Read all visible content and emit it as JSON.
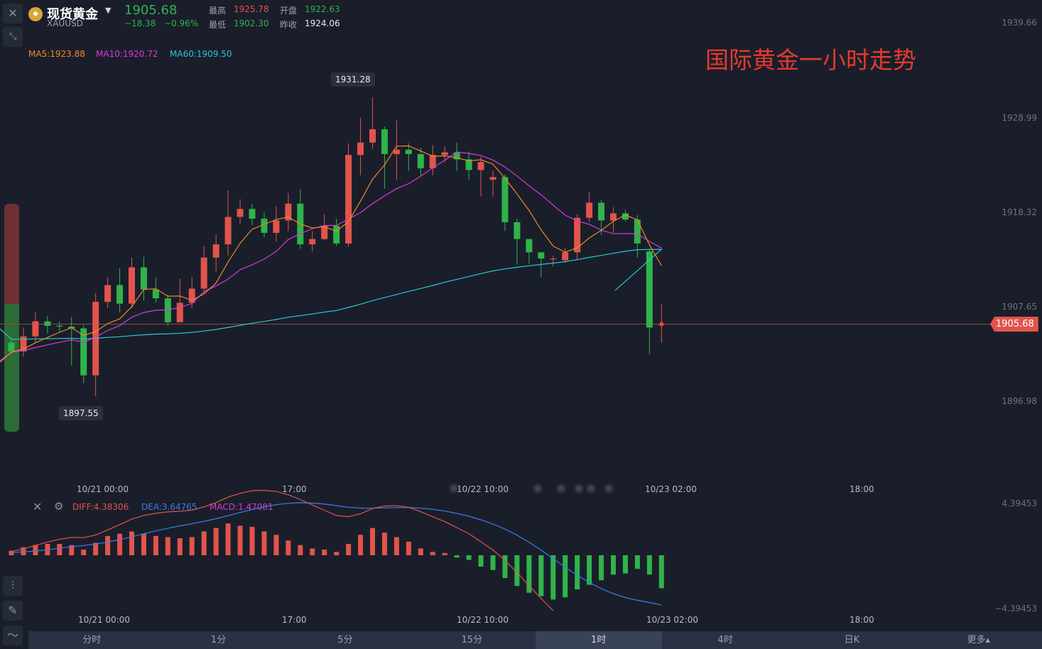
{
  "header": {
    "name": "现货黄金",
    "symbol": "XAUUSD",
    "price": "1905.68",
    "change": "−18.38",
    "change_pct": "−0.96%",
    "high_label": "最高",
    "high": "1925.78",
    "open_label": "开盘",
    "open": "1922.63",
    "low_label": "最低",
    "low": "1902.30",
    "prev_label": "昨收",
    "prev": "1924.06"
  },
  "ma_legend": {
    "ma5": "MA5:1923.88",
    "ma10": "MA10:1920.72",
    "ma60": "MA60:1909.50"
  },
  "annotation": "国际黄金一小时走势",
  "price_axis": [
    "1939.66",
    "1928.99",
    "1918.32",
    "1907.65",
    "1896.98"
  ],
  "current_price": "1905.68",
  "high_marker": "1931.28",
  "low_marker": "1897.55",
  "time_axis": [
    "10/21 00:00",
    "17:00",
    "10/22 10:00",
    "10/23 02:00",
    "18:00"
  ],
  "macd": {
    "diff": "DIFF:4.38306",
    "dea": "DEA:3.64765",
    "macd": "MACD:1.47081",
    "axis_top": "4.39453",
    "axis_bottom": "−4.39453"
  },
  "tabs": [
    "分时",
    "1分",
    "5分",
    "15分",
    "1时",
    "4时",
    "日K",
    "更多▴"
  ],
  "active_tab": "1时",
  "colors": {
    "up": "#e2544b",
    "down": "#2fb44a",
    "ma5": "#f08a24",
    "ma10": "#d83ad8",
    "ma60": "#2cc4d2",
    "dif": "#e2544b",
    "dea": "#3a7fe6"
  },
  "icons": {
    "close": "close-icon",
    "collapse": "collapse-icon",
    "gold": "gold-coin-icon",
    "dropdown": "chevron-down-icon",
    "settings": "gear-icon",
    "indicator": "indicator-icon",
    "draw": "pencil-icon",
    "chart-type": "line-chart-icon"
  },
  "candles": [
    [
      1903.6,
      1902.6,
      1904.2,
      1902.2
    ],
    [
      1902.6,
      1904.3,
      1905.3,
      1902.0
    ],
    [
      1904.3,
      1906.0,
      1907.0,
      1903.6
    ],
    [
      1906.0,
      1905.5,
      1906.6,
      1904.6
    ],
    [
      1905.5,
      1905.4,
      1906.0,
      1904.8
    ],
    [
      1905.4,
      1905.2,
      1906.5,
      1901.0
    ],
    [
      1905.2,
      1899.9,
      1905.6,
      1899.0
    ],
    [
      1899.9,
      1908.2,
      1909.2,
      1897.55
    ],
    [
      1908.2,
      1910.1,
      1911.0,
      1907.5
    ],
    [
      1910.1,
      1908.0,
      1912.0,
      1907.0
    ],
    [
      1908.0,
      1912.1,
      1913.2,
      1907.5
    ],
    [
      1912.1,
      1909.6,
      1913.3,
      1908.3
    ],
    [
      1909.6,
      1908.6,
      1911.0,
      1908.1
    ],
    [
      1908.6,
      1905.9,
      1909.0,
      1905.5
    ],
    [
      1905.9,
      1908.1,
      1910.8,
      1907.5
    ],
    [
      1908.1,
      1909.7,
      1911.0,
      1907.5
    ],
    [
      1909.7,
      1913.2,
      1914.5,
      1909.2
    ],
    [
      1913.2,
      1914.7,
      1915.8,
      1911.6
    ],
    [
      1914.7,
      1917.8,
      1920.8,
      1913.4
    ],
    [
      1917.8,
      1918.7,
      1919.8,
      1917.0
    ],
    [
      1918.7,
      1917.6,
      1919.3,
      1916.9
    ],
    [
      1917.6,
      1916.0,
      1918.3,
      1915.5
    ],
    [
      1916.0,
      1917.4,
      1919.0,
      1915.0
    ],
    [
      1917.4,
      1919.3,
      1920.5,
      1916.2
    ],
    [
      1919.3,
      1914.7,
      1920.9,
      1914.2
    ],
    [
      1914.7,
      1915.3,
      1916.2,
      1913.9
    ],
    [
      1915.3,
      1916.8,
      1918.1,
      1915.2
    ],
    [
      1916.8,
      1914.8,
      1917.6,
      1914.5
    ],
    [
      1914.8,
      1924.8,
      1926.1,
      1914.4
    ],
    [
      1924.8,
      1926.2,
      1929.0,
      1922.5
    ],
    [
      1926.2,
      1927.7,
      1931.28,
      1925.5
    ],
    [
      1927.7,
      1924.9,
      1928.0,
      1921.0
    ],
    [
      1924.9,
      1925.4,
      1928.7,
      1922.0
    ],
    [
      1925.4,
      1924.9,
      1926.1,
      1923.0
    ],
    [
      1924.9,
      1923.3,
      1925.6,
      1922.5
    ],
    [
      1923.3,
      1924.8,
      1925.9,
      1922.5
    ],
    [
      1924.8,
      1925.1,
      1925.8,
      1924.0
    ],
    [
      1925.1,
      1924.3,
      1926.2,
      1923.0
    ],
    [
      1924.3,
      1923.1,
      1925.2,
      1922.0
    ],
    [
      1923.1,
      1924.0,
      1924.6,
      1920.1
    ],
    [
      1922.0,
      1922.3,
      1923.0,
      1920.1
    ],
    [
      1922.3,
      1917.2,
      1922.6,
      1916.2
    ],
    [
      1917.2,
      1915.3,
      1917.6,
      1912.4
    ],
    [
      1915.3,
      1913.8,
      1914.4,
      1912.5
    ],
    [
      1913.8,
      1913.1,
      1913.6,
      1911.0
    ],
    [
      1913.1,
      1913.1,
      1913.4,
      1912.2
    ],
    [
      1912.9,
      1913.8,
      1914.3,
      1912.6
    ],
    [
      1913.8,
      1917.7,
      1918.1,
      1912.9
    ],
    [
      1917.7,
      1919.4,
      1920.6,
      1917.2
    ],
    [
      1919.4,
      1917.4,
      1919.7,
      1915.8
    ],
    [
      1917.4,
      1918.2,
      1918.9,
      1916.0
    ],
    [
      1918.2,
      1917.5,
      1918.6,
      1917.3
    ],
    [
      1917.5,
      1914.8,
      1918.0,
      1913.2
    ],
    [
      1913.9,
      1905.3,
      1914.2,
      1902.3
    ],
    [
      1905.68,
      1905.68,
      1907.9,
      1903.6
    ]
  ],
  "macd_hist": [
    0.4,
    0.7,
    0.9,
    1.0,
    1.0,
    0.9,
    0.5,
    1.1,
    1.7,
    1.9,
    2.1,
    1.9,
    1.7,
    1.6,
    1.5,
    1.6,
    2.1,
    2.4,
    2.8,
    2.6,
    2.5,
    2.1,
    1.8,
    1.3,
    0.9,
    0.6,
    0.5,
    0.3,
    1.0,
    1.8,
    2.4,
    2.0,
    1.6,
    1.2,
    0.6,
    0.3,
    0.2,
    -0.2,
    -0.4,
    -1.0,
    -1.3,
    -2.0,
    -2.7,
    -3.3,
    -3.6,
    -3.9,
    -3.7,
    -3.0,
    -2.6,
    -2.2,
    -1.7,
    -1.6,
    -1.2,
    -1.7,
    -2.9
  ]
}
